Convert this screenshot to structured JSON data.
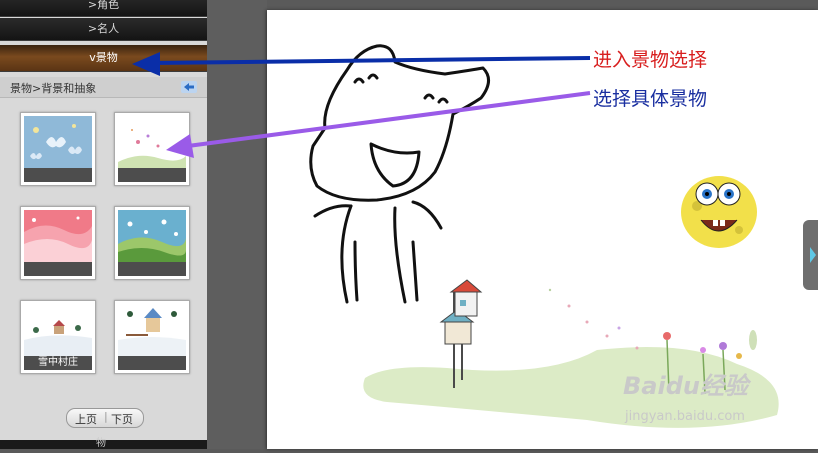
{
  "sidebar": {
    "menu": [
      {
        "label": ">角色"
      },
      {
        "label": ">名人"
      },
      {
        "label": "v景物"
      }
    ],
    "breadcrumb": "景物>背景和抽象",
    "thumbnails": [
      {
        "caption": ""
      },
      {
        "caption": ""
      },
      {
        "caption": ""
      },
      {
        "caption": ""
      },
      {
        "caption": "雪中村庄"
      },
      {
        "caption": ""
      }
    ],
    "pager": {
      "prev": "上页",
      "next": "下页"
    },
    "bottom_label": "物"
  },
  "annotations": {
    "enter_scenery": "进入景物选择",
    "choose_scenery": "选择具体景物"
  },
  "watermark": {
    "logo": "Baidu经验",
    "url": "jingyan.baidu.com"
  },
  "colors": {
    "annotation_red": "#d81e1e",
    "annotation_blue": "#1a2fa0",
    "arrow_blue": "#0a2ea8",
    "arrow_purple": "#9a5be8",
    "active_menu": "#7a4a1e"
  }
}
